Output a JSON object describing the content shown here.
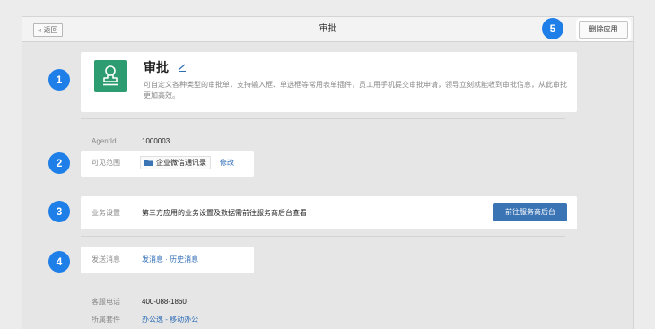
{
  "header": {
    "back_label": "« 返回",
    "title": "审批",
    "delete_label": "删除应用"
  },
  "app": {
    "name": "审批",
    "description": "可自定义各种类型的审批单，支持输入框、单选框等常用表单插件，员工用手机提交审批申请，领导立刻就能收到审批信息，从此审批更加高效。",
    "icon": "stamp-icon",
    "icon_color": "#2e9c71"
  },
  "details": {
    "agentid_label": "AgentId",
    "agentid_value": "1000003",
    "scope_label": "可见范围",
    "scope_value": "企业微信通讯录",
    "scope_edit": "修改",
    "business_label": "业务设置",
    "business_value": "第三方应用的业务设置及数据需前往服务商后台查看",
    "service_button": "前往服务商后台",
    "message_label": "发送消息",
    "message_links": "发消息 · 历史消息",
    "support_label": "客服电话",
    "support_value": "400-088-1860",
    "suite_label": "所属套件",
    "suite_value": "办公逸 - 移动办公"
  },
  "badges": [
    "1",
    "2",
    "3",
    "4",
    "5"
  ],
  "colors": {
    "badge": "#1f7fe8",
    "link": "#2f6db6",
    "primary_button": "#3a74b5"
  }
}
